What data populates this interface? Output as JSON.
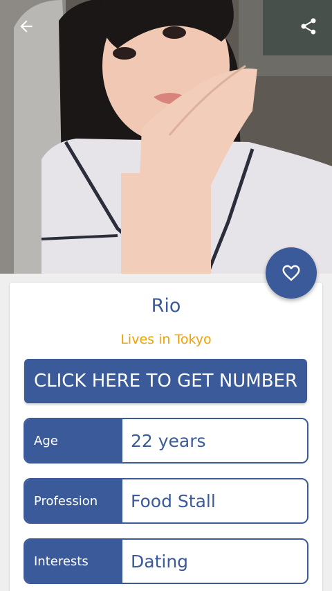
{
  "header": {
    "back_icon": "arrow-left-icon",
    "share_icon": "share-icon"
  },
  "profile": {
    "name": "Rio",
    "location": "Lives in Tokyo",
    "favorite_icon": "heart-outline-icon"
  },
  "cta": {
    "label": "CLICK HERE TO GET NUMBER"
  },
  "details": [
    {
      "label": "Age",
      "value": "22 years"
    },
    {
      "label": "Profession",
      "value": "Food Stall"
    },
    {
      "label": "Interests",
      "value": "Dating"
    }
  ],
  "colors": {
    "primary": "#3b5a9a",
    "accent": "#f0a000",
    "background": "#efefef",
    "card": "#ffffff"
  }
}
